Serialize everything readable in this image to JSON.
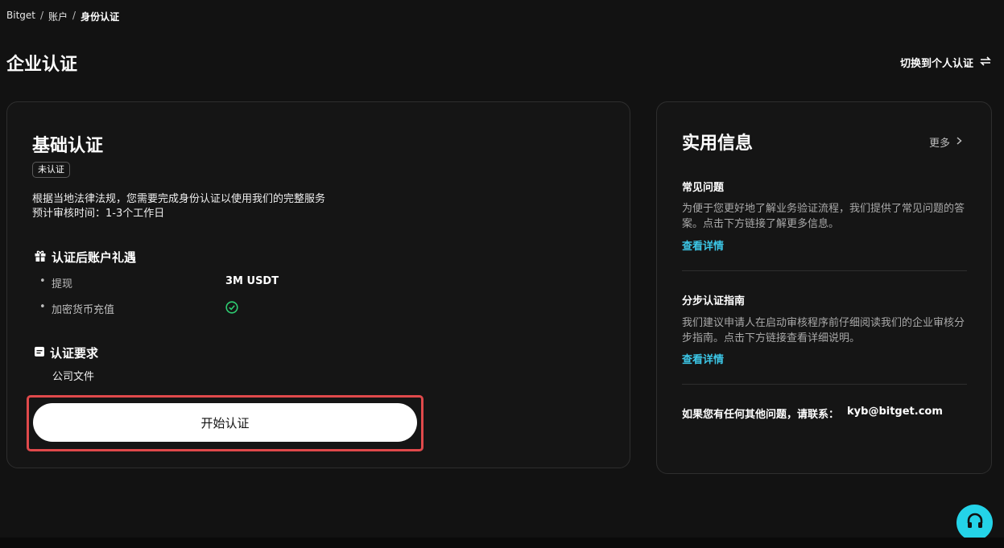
{
  "breadcrumb": {
    "items": [
      "Bitget",
      "账户",
      "身份认证"
    ],
    "separator": "/"
  },
  "page_title": "企业认证",
  "switch_link": {
    "label": "切换到个人认证",
    "icon": "swap-icon"
  },
  "basic_card": {
    "title": "基础认证",
    "badge": "未认证",
    "description_line1": "根据当地法律法规，您需要完成身份认证以使用我们的完整服务",
    "description_line2": "预计审核时间：1-3个工作日",
    "benefits_title": "认证后账户礼遇",
    "benefits": [
      {
        "label": "提现",
        "value": "3M USDT"
      },
      {
        "label": "加密货币充值",
        "value": "",
        "icon": "check-circle-icon"
      }
    ],
    "requirements_title": "认证要求",
    "requirements": [
      "公司文件"
    ],
    "start_button": "开始认证"
  },
  "info_card": {
    "title": "实用信息",
    "more_label": "更多",
    "faq": {
      "title": "常见问题",
      "text": "为便于您更好地了解业务验证流程，我们提供了常见问题的答案。点击下方链接了解更多信息。",
      "link": "查看详情"
    },
    "guide": {
      "title": "分步认证指南",
      "text": "我们建议申请人在启动审核程序前仔细阅读我们的企业审核分步指南。点击下方链接查看详细说明。",
      "link": "查看详情"
    },
    "contact_label": "如果您有任何其他问题，请联系：",
    "contact_email": "kyb@bitget.com"
  },
  "support_button": {
    "icon": "headset-icon"
  },
  "colors": {
    "background": "#121212",
    "card": "#151515",
    "accent_link": "#3cc6e6",
    "support": "#24d3e8",
    "check": "#2ecc71",
    "highlight": "#e0494b"
  }
}
